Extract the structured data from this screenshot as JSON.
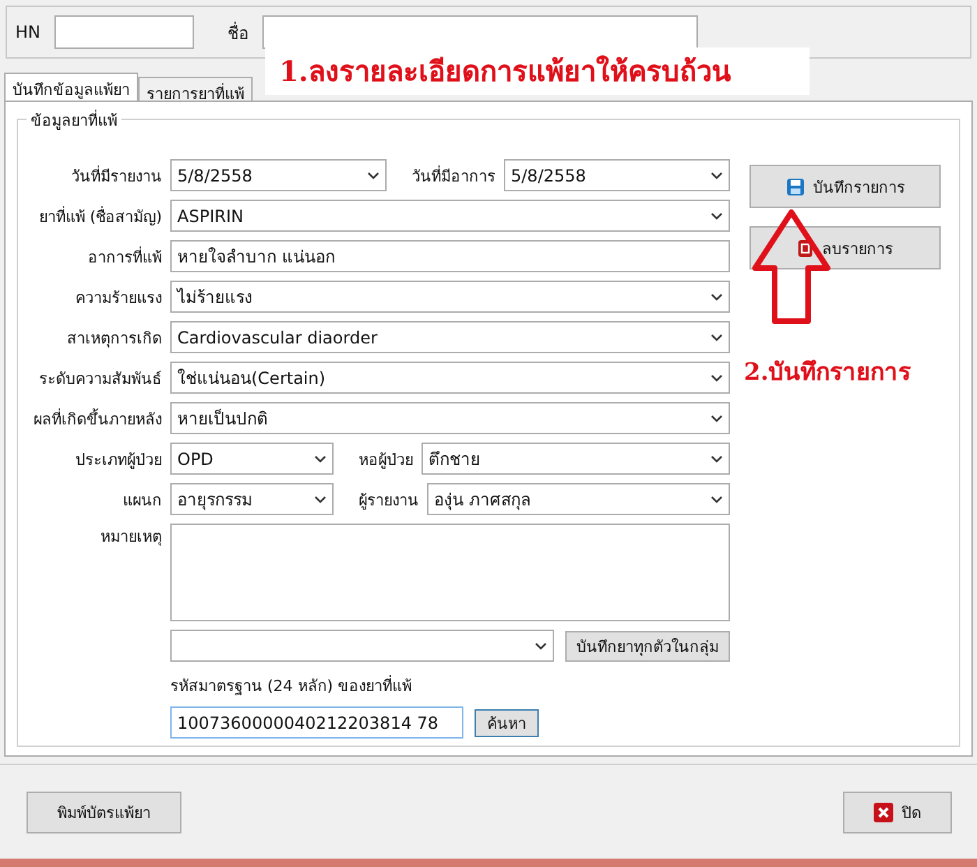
{
  "header": {
    "hn_label": "HN",
    "name_label": "ชื่อ"
  },
  "tabs": [
    {
      "label": "บันทึกข้อมูลแพ้ยา",
      "selected": true
    },
    {
      "label": "รายการยาที่แพ้",
      "selected": false
    }
  ],
  "group_title": "ข้อมูลยาที่แพ้",
  "rows": [
    {
      "fields": [
        {
          "label": "วันที่มีรายงาน",
          "kind": "combo",
          "value": "5/8/2558"
        },
        {
          "label": "วันที่มีอาการ",
          "kind": "combo",
          "value": "5/8/2558"
        }
      ]
    },
    {
      "fields": [
        {
          "label": "ยาที่แพ้ (ชื่อสามัญ)",
          "kind": "combo",
          "value": "ASPIRIN"
        }
      ]
    },
    {
      "fields": [
        {
          "label": "อาการที่แพ้",
          "kind": "text",
          "value": "หายใจลำบาก แน่นอก"
        }
      ]
    },
    {
      "fields": [
        {
          "label": "ความร้ายแรง",
          "kind": "combo",
          "value": "ไม่ร้ายแรง"
        }
      ]
    },
    {
      "fields": [
        {
          "label": "สาเหตุการเกิด",
          "kind": "combo",
          "value": "Cardiovascular diaorder"
        }
      ]
    },
    {
      "fields": [
        {
          "label": "ระดับความสัมพันธ์",
          "kind": "combo",
          "value": "ใช่แน่นอน(Certain)"
        }
      ]
    },
    {
      "fields": [
        {
          "label": "ผลที่เกิดขึ้นภายหลัง",
          "kind": "combo",
          "value": "หายเป็นปกติ"
        }
      ]
    },
    {
      "fields": [
        {
          "label": "ประเภทผู้ป่วย",
          "kind": "combo",
          "value": "OPD"
        },
        {
          "label": "หอผู้ป่วย",
          "kind": "combo",
          "value": "ตึกชาย"
        }
      ]
    },
    {
      "fields": [
        {
          "label": "แผนก",
          "kind": "combo",
          "value": "อายุรกรรม"
        },
        {
          "label": "ผู้รายงาน",
          "kind": "combo",
          "value": "องุ่น ภาศสกุล"
        }
      ]
    },
    {
      "fields": [
        {
          "label": "หมายเหตุ",
          "kind": "memo"
        }
      ]
    }
  ],
  "group_combo_button": "บันทึกยาทุกตัวในกลุ่ม",
  "code_label": "รหัสมาตรฐาน (24 หลัก) ของยาที่แพ้",
  "code_value": "1007360000040212203814 78",
  "search_button": "ค้นหา",
  "side_buttons": [
    {
      "label": "บันทึกรายการ",
      "kind": "save"
    },
    {
      "label": "ลบรายการ",
      "kind": "delete"
    }
  ],
  "footer": {
    "print_button": "พิมพ์บัตรแพ้ยา",
    "close_button": "ปิด"
  },
  "annotations": [
    {
      "text": "1.ลงรายละเอียดการแพ้ยาให้ครบถ้วน"
    },
    {
      "text": "2.บันทึกรายการ"
    }
  ]
}
